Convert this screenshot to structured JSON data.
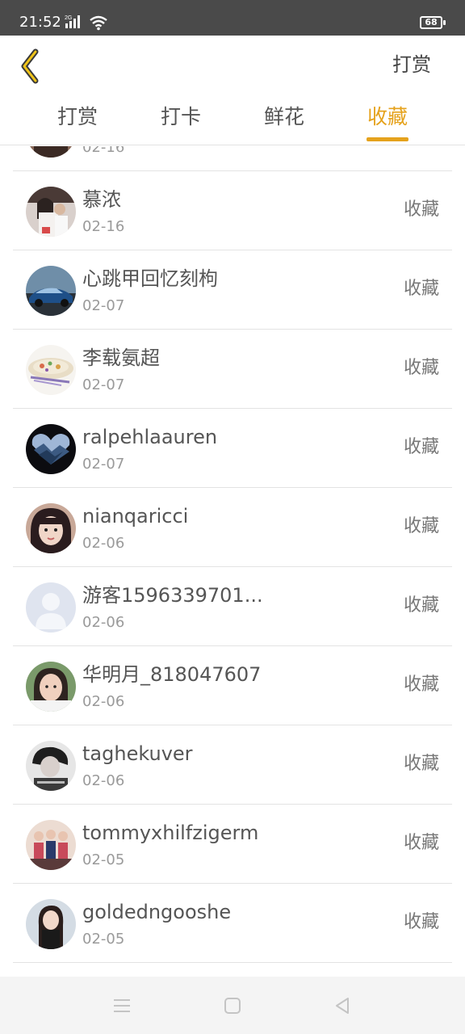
{
  "status_bar": {
    "time": "21:52",
    "network_label": "2G",
    "battery": "68",
    "icons": [
      "signal-icon",
      "wifi-icon",
      "battery-icon"
    ]
  },
  "header": {
    "back_icon": "chevron-left-icon",
    "action_label": "打赏",
    "accent_color": "#e5a21c"
  },
  "tabs": [
    {
      "label": "打赏",
      "active": false
    },
    {
      "label": "打卡",
      "active": false
    },
    {
      "label": "鲜花",
      "active": false
    },
    {
      "label": "收藏",
      "active": true
    }
  ],
  "list": {
    "partial_top": {
      "date": "02-16"
    },
    "items": [
      {
        "name": "慕浓",
        "date": "02-16",
        "action": "收藏",
        "avatar_icon": "avatar-photo"
      },
      {
        "name": "心跳甲回忆刻枸",
        "date": "02-07",
        "action": "收藏",
        "avatar_icon": "avatar-car"
      },
      {
        "name": "李载氨超",
        "date": "02-07",
        "action": "收藏",
        "avatar_icon": "avatar-food"
      },
      {
        "name": "ralpehlaauren",
        "date": "02-07",
        "action": "收藏",
        "avatar_icon": "avatar-landscape"
      },
      {
        "name": "nianqaricci",
        "date": "02-06",
        "action": "收藏",
        "avatar_icon": "avatar-photo"
      },
      {
        "name": "游客1596339701...",
        "date": "02-06",
        "action": "收藏",
        "avatar_icon": "avatar-default"
      },
      {
        "name": "华明月_818047607",
        "date": "02-06",
        "action": "收藏",
        "avatar_icon": "avatar-photo"
      },
      {
        "name": "taghekuver",
        "date": "02-06",
        "action": "收藏",
        "avatar_icon": "avatar-photo"
      },
      {
        "name": "tommyxhilfzigerm",
        "date": "02-05",
        "action": "收藏",
        "avatar_icon": "avatar-photo"
      },
      {
        "name": "goldedngooshe",
        "date": "02-05",
        "action": "收藏",
        "avatar_icon": "avatar-photo"
      }
    ]
  },
  "nav_bar": {
    "icons": [
      "menu-icon",
      "home-square-icon",
      "back-triangle-icon"
    ]
  }
}
